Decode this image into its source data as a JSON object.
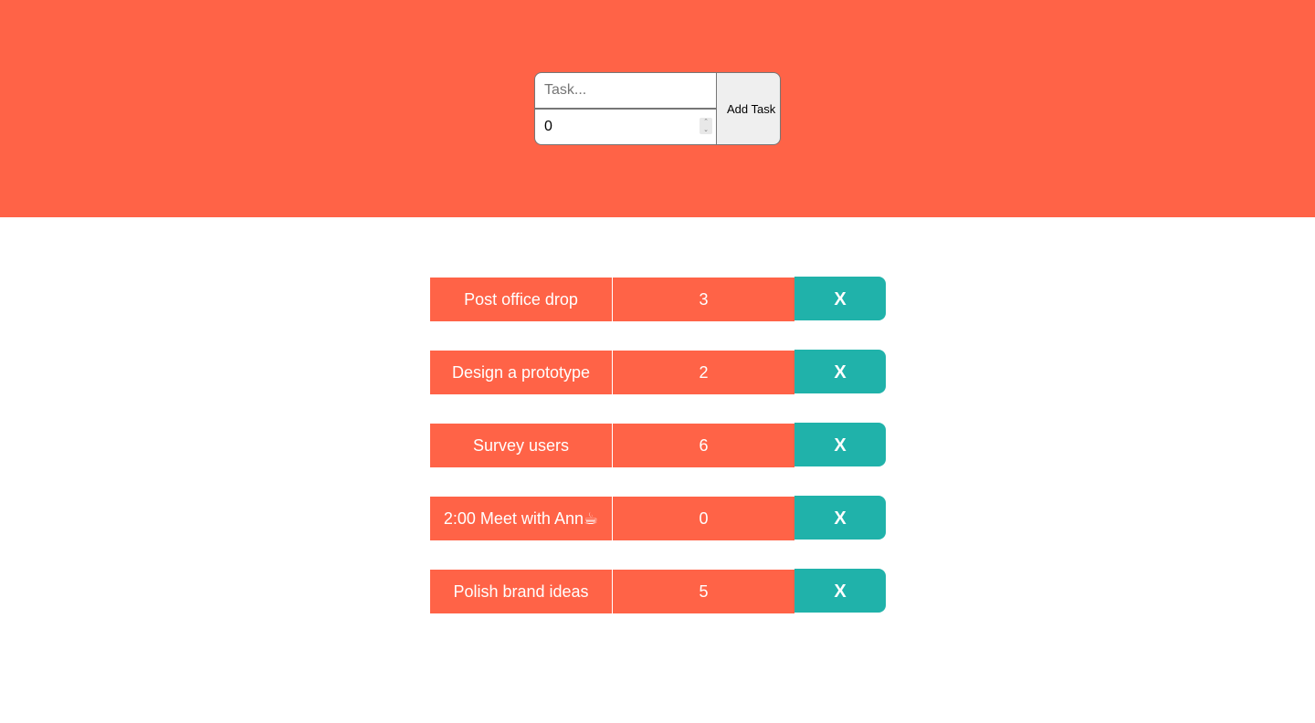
{
  "form": {
    "task_placeholder": "Task...",
    "task_value": "",
    "count_value": "0",
    "add_button_label": "Add Task"
  },
  "tasks": [
    {
      "name": "Post office drop",
      "count": "3",
      "delete_label": "X"
    },
    {
      "name": "Design a prototype",
      "count": "2",
      "delete_label": "X"
    },
    {
      "name": "Survey users",
      "count": "6",
      "delete_label": "X"
    },
    {
      "name": "2:00 Meet with Ann☕",
      "count": "0",
      "delete_label": "X"
    },
    {
      "name": "Polish brand ideas",
      "count": "5",
      "delete_label": "X"
    }
  ],
  "colors": {
    "header_background": "#ff6347",
    "task_cell": "#ff6347",
    "delete_button": "#20b2aa",
    "page_background": "#ffffff"
  },
  "icons": {
    "spinner": "number-stepper-icon"
  }
}
